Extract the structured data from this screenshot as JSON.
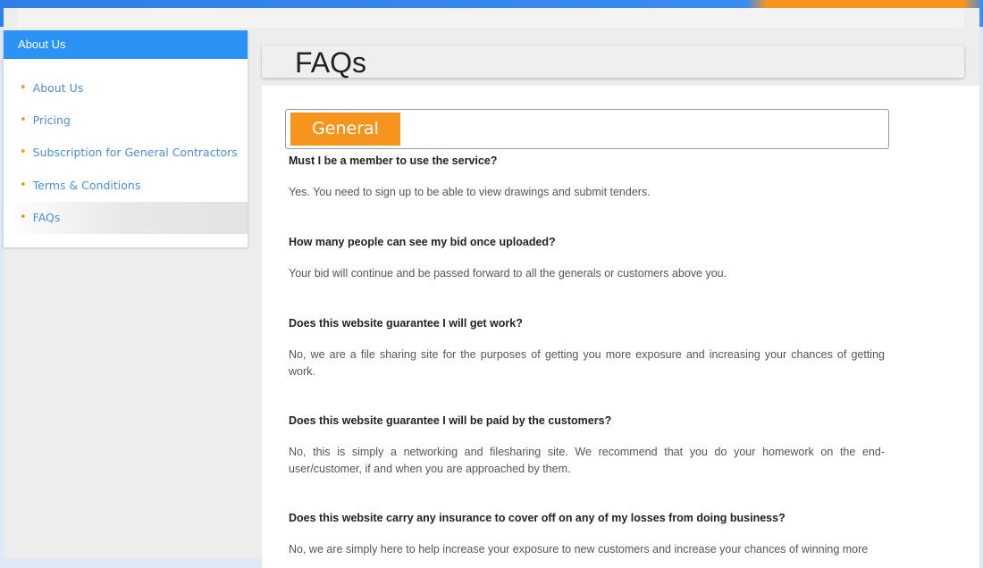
{
  "sidebar": {
    "header": "About Us",
    "items": [
      {
        "label": "About Us"
      },
      {
        "label": "Pricing"
      },
      {
        "label": "Subscription for General Contractors"
      },
      {
        "label": "Terms & Conditions"
      },
      {
        "label": "FAQs"
      }
    ],
    "active_index": 4
  },
  "page": {
    "title": "FAQs"
  },
  "section": {
    "title": "General"
  },
  "faqs": [
    {
      "question": "Must I be a member to use the service?",
      "answer": "Yes. You need to sign up to be able to view drawings and submit tenders."
    },
    {
      "question": "How many people can see my bid once uploaded?",
      "answer": "Your bid will continue and be passed forward to all the generals or customers above you."
    },
    {
      "question": "Does this website guarantee I will get work?",
      "answer": "No, we are a file sharing site for the purposes of getting you more exposure and increasing your chances of getting work."
    },
    {
      "question": "Does this website guarantee I will be paid by the customers?",
      "answer": "No, this is simply a networking and filesharing site. We recommend that you do your homework on the end-user/customer, if and when you are approached by them."
    },
    {
      "question": "Does this website carry any insurance to cover off on any of my losses from doing business?",
      "answer": "No, we are simply here to help increase your exposure to new customers and increase your chances of winning more"
    }
  ],
  "colors": {
    "accent_blue": "#2b93f5",
    "accent_orange": "#f7941d",
    "link_blue": "#4d8ed6"
  }
}
